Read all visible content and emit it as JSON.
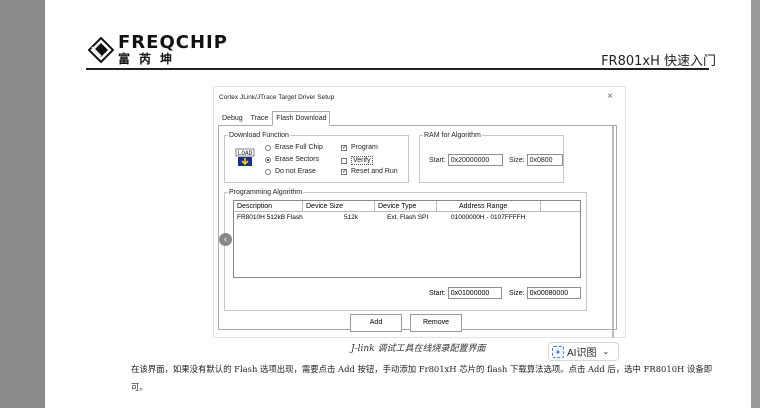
{
  "header": {
    "logo_en": "FREQCHIP",
    "logo_cn": "富芮坤",
    "doc_title": "FR801xH 快速入门"
  },
  "dialog": {
    "title": "Cortex JLink/JTrace Target Driver Setup",
    "close": "×",
    "tabs": [
      "Debug",
      "Trace",
      "Flash Download"
    ],
    "active_tab": "Flash Download",
    "download_function": {
      "legend": "Download Function",
      "icon_label": "LOAD",
      "radios": [
        {
          "label": "Erase Full Chip",
          "checked": false
        },
        {
          "label": "Erase Sectors",
          "checked": true
        },
        {
          "label": "Do not Erase",
          "checked": false
        }
      ],
      "checks": [
        {
          "label": "Program",
          "checked": true
        },
        {
          "label": "Verify",
          "checked": false
        },
        {
          "label": "Reset and Run",
          "checked": true
        }
      ]
    },
    "ram": {
      "legend": "RAM for Algorithm",
      "start_label": "Start:",
      "start_value": "0x20000000",
      "size_label": "Size:",
      "size_value": "0x0800"
    },
    "algorithm": {
      "legend": "Programming Algorithm",
      "columns": [
        "Description",
        "Device Size",
        "Device Type",
        "Address Range"
      ],
      "rows": [
        [
          "FR8010H 512kB Flash",
          "512k",
          "Ext. Flash SPI",
          "01000000H - 0107FFFFH"
        ]
      ],
      "start_label": "Start:",
      "start_value": "0x01000000",
      "size_label": "Size:",
      "size_value": "0x00080000"
    },
    "add_label": "Add",
    "remove_label": "Remove"
  },
  "caption": "J-link 调试工具在线烧录配置界面",
  "ai_button": {
    "label": "AI识图"
  },
  "body_text": "在该界面，如果没有默认的 Flash 选项出现，需要点击 Add 按钮，手动添加 Fr801xH 芯片的 flash 下载算法选项。点击 Add 后，选中 FR8010H 设备即可。",
  "colors": {
    "accent": "#3a7be0",
    "page_bg": "#8a8a8a"
  }
}
